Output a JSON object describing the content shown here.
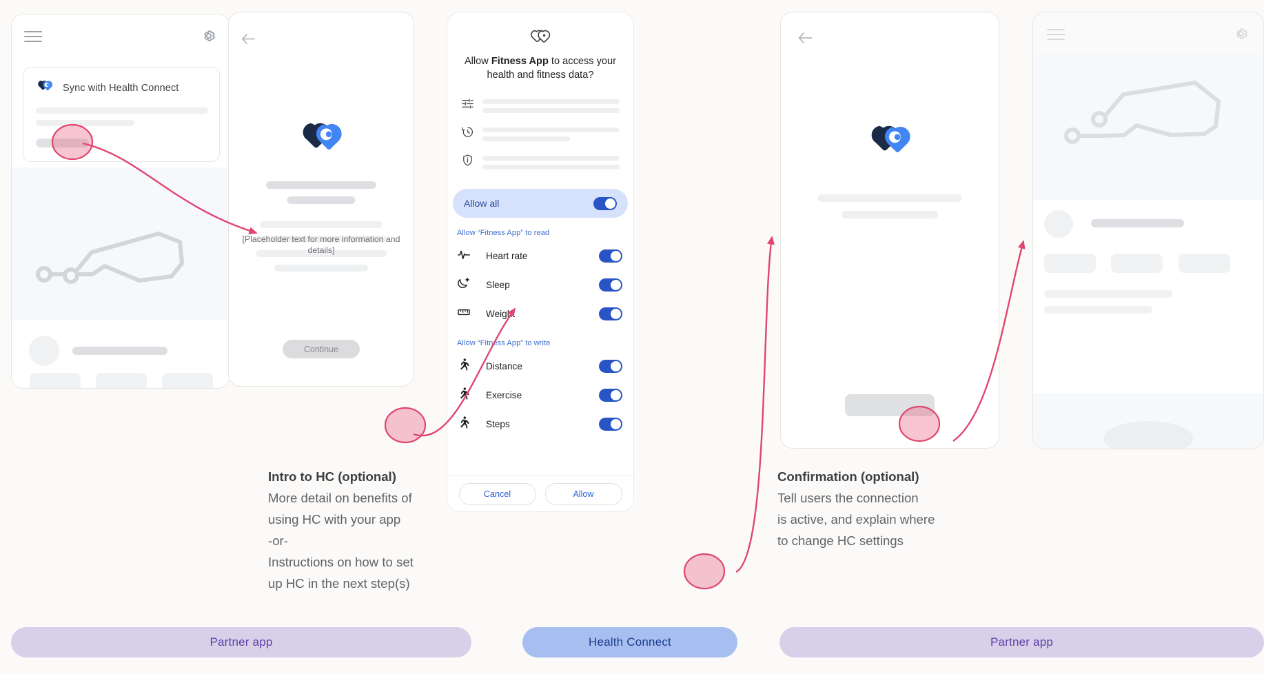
{
  "page": {
    "background": "#FBFAF8",
    "accent_pink": "#E0466F",
    "accent_blue": "#2854C5",
    "link_blue": "#3C6FD1"
  },
  "panel1": {
    "name": "partner-app-home",
    "menu_icon": "hamburger-menu-icon",
    "settings_icon": "gear-icon",
    "card": {
      "logo_icon": "health-connect-logo-icon",
      "title": "Sync with Health Connect"
    }
  },
  "panel2": {
    "name": "intro-to-health-connect",
    "back_icon": "back-arrow-icon",
    "logo_icon": "health-connect-logo-icon",
    "placeholder_text": "[Placeholder text for more information and details]",
    "continue_label": "Continue"
  },
  "panel3": {
    "name": "health-connect-permission-dialog",
    "logo_icon": "health-connect-outline-logo-icon",
    "title_prefix": "Allow ",
    "title_app": "Fitness App",
    "title_suffix": " to access your health and fitness data?",
    "info_rows": [
      {
        "icon": "tune-sliders-icon"
      },
      {
        "icon": "history-clock-icon"
      },
      {
        "icon": "shield-info-icon"
      }
    ],
    "allow_all": {
      "label": "Allow all",
      "toggle_on": true
    },
    "read_section": {
      "header": "Allow “Fitness App” to read",
      "items": [
        {
          "icon": "heart-rate-icon",
          "label": "Heart rate",
          "toggle_on": true
        },
        {
          "icon": "sleep-moon-icon",
          "label": "Sleep",
          "toggle_on": true
        },
        {
          "icon": "weight-scale-icon",
          "label": "Weight",
          "toggle_on": true
        }
      ]
    },
    "write_section": {
      "header": "Allow “Fitness App” to write",
      "items": [
        {
          "icon": "distance-runner-icon",
          "label": "Distance",
          "toggle_on": true
        },
        {
          "icon": "exercise-runner-icon",
          "label": "Exercise",
          "toggle_on": true
        },
        {
          "icon": "steps-runner-icon",
          "label": "Steps",
          "toggle_on": true
        }
      ]
    },
    "actions": {
      "cancel_label": "Cancel",
      "allow_label": "Allow"
    }
  },
  "panel4": {
    "name": "confirmation-screen",
    "back_icon": "back-arrow-icon",
    "logo_icon": "health-connect-logo-icon"
  },
  "panel5": {
    "name": "partner-app-home-connected",
    "menu_icon": "hamburger-menu-icon",
    "settings_icon": "gear-icon"
  },
  "captions": {
    "intro": {
      "heading": "Intro to HC (optional)",
      "line1": "More detail on benefits of",
      "line2": "using HC with your app",
      "line3": "-or-",
      "line4": "Instructions on how to set",
      "line5": "up HC in the next step(s)"
    },
    "confirmation": {
      "heading": "Confirmation (optional)",
      "line1": "Tell users the connection",
      "line2": "is active, and explain where",
      "line3": "to change HC settings"
    }
  },
  "legend": {
    "partner_app_left": "Partner app",
    "health_connect": "Health Connect",
    "partner_app_right": "Partner app"
  }
}
